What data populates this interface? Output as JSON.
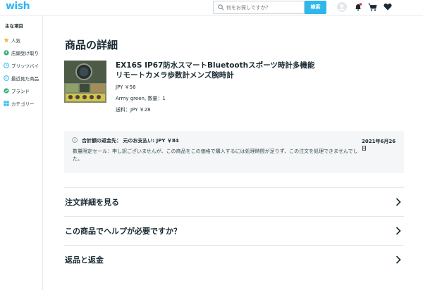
{
  "header": {
    "logo": "wish",
    "search_placeholder": "何をお探しですか？",
    "search_button": "検索"
  },
  "sidebar": {
    "title": "主な項目",
    "items": [
      {
        "label": "人気",
        "icon": "star-icon"
      },
      {
        "label": "店頭受け取り",
        "icon": "map-pin-icon"
      },
      {
        "label": "ブリッツバイ",
        "icon": "clock-icon"
      },
      {
        "label": "最近見た商品",
        "icon": "history-icon"
      },
      {
        "label": "ブランド",
        "icon": "verified-badge-icon"
      },
      {
        "label": "カテゴリー",
        "icon": "grid-icon"
      }
    ]
  },
  "main": {
    "page_title": "商品の詳細",
    "product": {
      "name": "EX16S IP67防水スマートBluetoothスポーツ時計多機能リモートカメラ歩数計メンズ腕時計",
      "price": "JPY ￥56",
      "variant": "Army green, 数量：1",
      "shipping": "送料：JPY ￥28"
    },
    "notice": {
      "title": "合計額の返金先： 元のお支払い: JPY ￥84",
      "body": "数量限定セール：申し訳ございませんが、この商品をこの価格で購入するには処理時間が足りず、この注文を処理できませんでした。",
      "date": "2021年6月26日"
    },
    "rows": [
      {
        "label": "注文詳細を見る"
      },
      {
        "label": "この商品でヘルプが必要ですか？"
      },
      {
        "label": "返品と返金"
      }
    ]
  },
  "colors": {
    "brand": "#2fb7ec",
    "notification_dot": "#e8334a",
    "text": "#192a32",
    "notice_bg": "#f4f6f7"
  }
}
